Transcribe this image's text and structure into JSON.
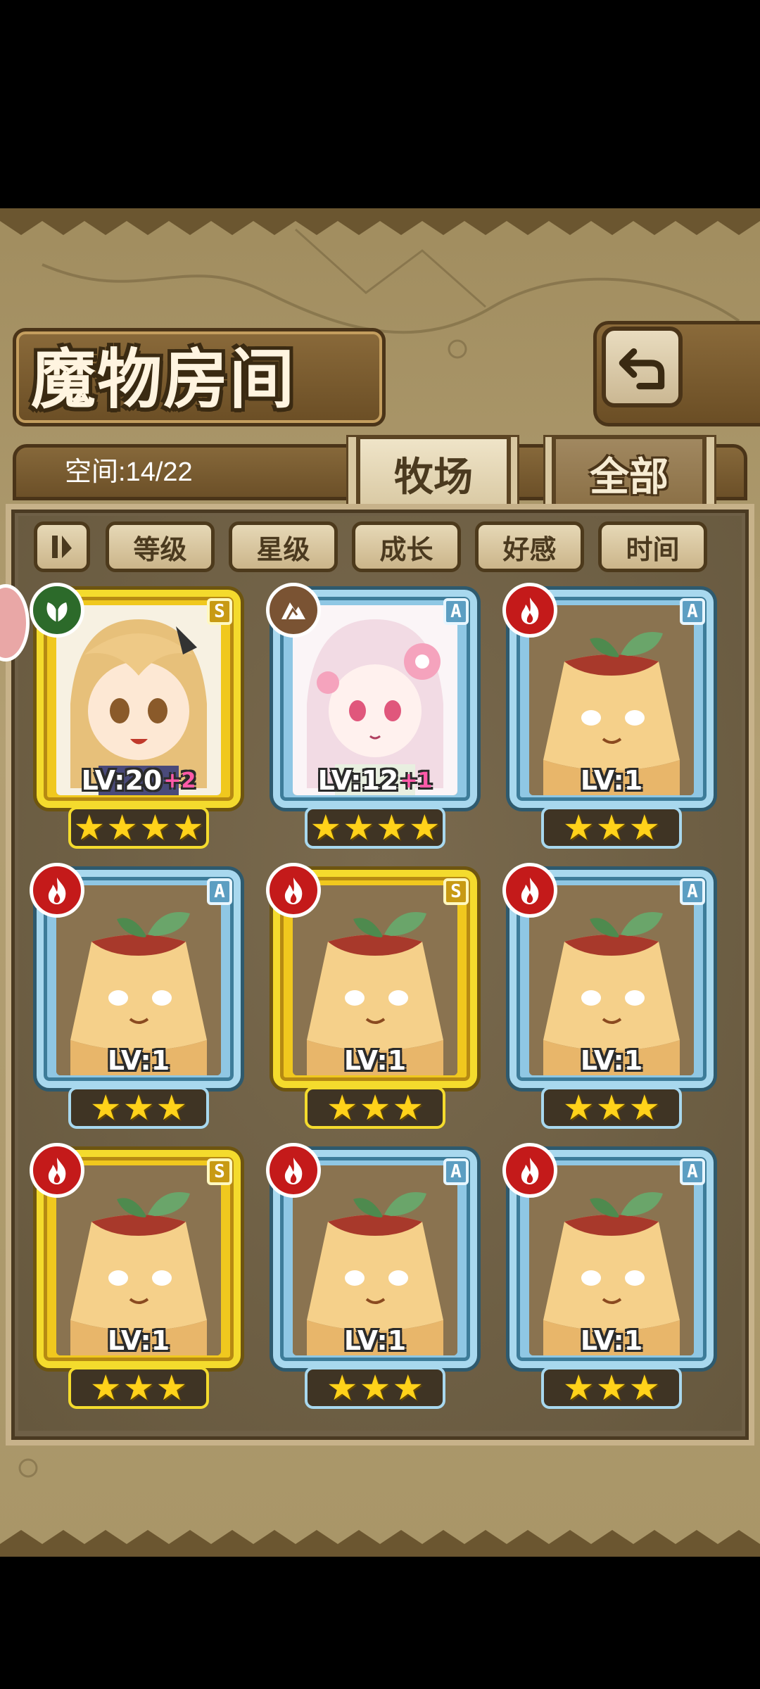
{
  "title": "魔物房间",
  "space": {
    "label": "空间:14/22"
  },
  "tabs": [
    {
      "label": "牧场",
      "active": true
    },
    {
      "label": "全部",
      "active": false
    }
  ],
  "sort": [
    "等级",
    "星级",
    "成长",
    "好感",
    "时间"
  ],
  "icons": {
    "back": "back-arrow-icon",
    "sort_toggle": "sort-toggle-icon"
  },
  "colors": {
    "gold_frame": "#f4db2d",
    "blue_frame": "#a8d8ee",
    "fire": "#c41a1a",
    "leaf": "#2c6a2a",
    "rock": "#7a5333",
    "star": "#ffd21a"
  },
  "cards": [
    {
      "frame": "gold",
      "rank": "S",
      "element": "leaf",
      "art": "blonde-girl",
      "lv_label": "LV:",
      "lv": "20",
      "bonus": "+2",
      "stars": 4
    },
    {
      "frame": "blue",
      "rank": "A",
      "element": "rock",
      "art": "sakura-girl",
      "lv_label": "LV:",
      "lv": "12",
      "bonus": "+1",
      "stars": 4
    },
    {
      "frame": "blue",
      "rank": "A",
      "element": "fire",
      "art": "pudding",
      "lv_label": "LV:",
      "lv": "1",
      "bonus": "",
      "stars": 3
    },
    {
      "frame": "blue",
      "rank": "A",
      "element": "fire",
      "art": "pudding",
      "lv_label": "LV:",
      "lv": "1",
      "bonus": "",
      "stars": 3
    },
    {
      "frame": "gold",
      "rank": "S",
      "element": "fire",
      "art": "pudding",
      "lv_label": "LV:",
      "lv": "1",
      "bonus": "",
      "stars": 3
    },
    {
      "frame": "blue",
      "rank": "A",
      "element": "fire",
      "art": "pudding",
      "lv_label": "LV:",
      "lv": "1",
      "bonus": "",
      "stars": 3
    },
    {
      "frame": "gold",
      "rank": "S",
      "element": "fire",
      "art": "pudding",
      "lv_label": "LV:",
      "lv": "1",
      "bonus": "",
      "stars": 3
    },
    {
      "frame": "blue",
      "rank": "A",
      "element": "fire",
      "art": "pudding",
      "lv_label": "LV:",
      "lv": "1",
      "bonus": "",
      "stars": 3
    },
    {
      "frame": "blue",
      "rank": "A",
      "element": "fire",
      "art": "pudding",
      "lv_label": "LV:",
      "lv": "1",
      "bonus": "",
      "stars": 3
    }
  ]
}
